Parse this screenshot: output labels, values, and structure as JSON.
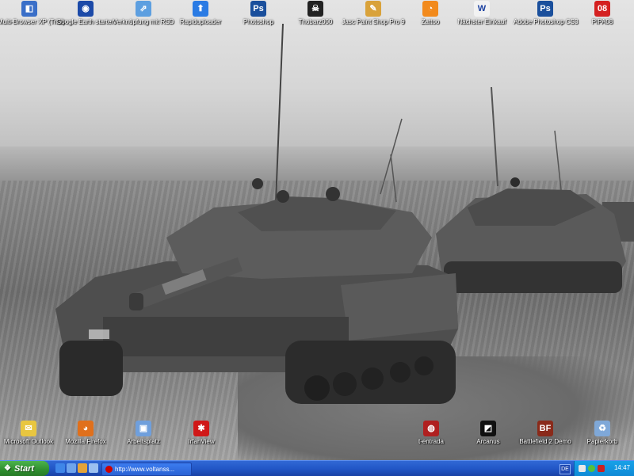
{
  "desktop": {
    "top_icons": [
      {
        "label": "Multi-Browser XP (Trial)",
        "icon": "multibrowser-icon",
        "color": "#3a6fc8",
        "glyph": "◧"
      },
      {
        "label": "Google Earth starten",
        "icon": "google-earth-icon",
        "color": "#1c4aa8",
        "glyph": "◉"
      },
      {
        "label": "Verknüpfung mit RSD",
        "icon": "shortcut-icon",
        "color": "#5d9fe0",
        "glyph": "⇗"
      },
      {
        "label": "Rapiduploader",
        "icon": "upload-arrow-icon",
        "color": "#2a7be4",
        "glyph": "⬆"
      },
      {
        "label": "Photoshop",
        "icon": "photoshop-icon",
        "color": "#1a4f9c",
        "glyph": "Ps"
      },
      {
        "label": "Thobarz000",
        "icon": "skull-icon",
        "color": "#222222",
        "glyph": "☠"
      },
      {
        "label": "Jasc Paint Shop Pro 9",
        "icon": "paint-palette-icon",
        "color": "#d9a23a",
        "glyph": "✎"
      },
      {
        "label": "Zattoo",
        "icon": "zattoo-icon",
        "color": "#f28a1c",
        "glyph": "◔"
      },
      {
        "label": "Nächster Einkauf",
        "icon": "word-document-icon",
        "color": "#f2f2f2",
        "glyph": "W"
      },
      {
        "label": "Adobe Photoshop CS3",
        "icon": "photoshop-cs3-icon",
        "color": "#1a4f9c",
        "glyph": "Ps"
      },
      {
        "label": "PIPA08",
        "icon": "pipa-icon",
        "color": "#d42020",
        "glyph": "08"
      }
    ],
    "bottom_icons": [
      {
        "label": "Microsoft Outlook",
        "icon": "outlook-icon",
        "color": "#e8c640",
        "glyph": "✉"
      },
      {
        "label": "Mozilla Firefox",
        "icon": "firefox-icon",
        "color": "#e0701c",
        "glyph": "◕"
      },
      {
        "label": "Arbeitsplatz",
        "icon": "my-computer-icon",
        "color": "#6f9fdc",
        "glyph": "▣"
      },
      {
        "label": "IrfanView",
        "icon": "irfanview-icon",
        "color": "#d01818",
        "glyph": "✱"
      },
      {
        "label": "t-entrada",
        "icon": "entrada-icon",
        "color": "#b02020",
        "glyph": "◍"
      },
      {
        "label": "Arcanus",
        "icon": "arcanus-icon",
        "color": "#101010",
        "glyph": "◩"
      },
      {
        "label": "Battlefield 2 Demo",
        "icon": "battlefield-icon",
        "color": "#8a2a1a",
        "glyph": "BF"
      },
      {
        "label": "Papierkorb",
        "icon": "recycle-bin-icon",
        "color": "#7fa8d8",
        "glyph": "♻"
      }
    ]
  },
  "taskbar": {
    "start_label": "Start",
    "task_button_label": "http://www.voltanss...",
    "language": "DE",
    "clock": "14:47"
  }
}
